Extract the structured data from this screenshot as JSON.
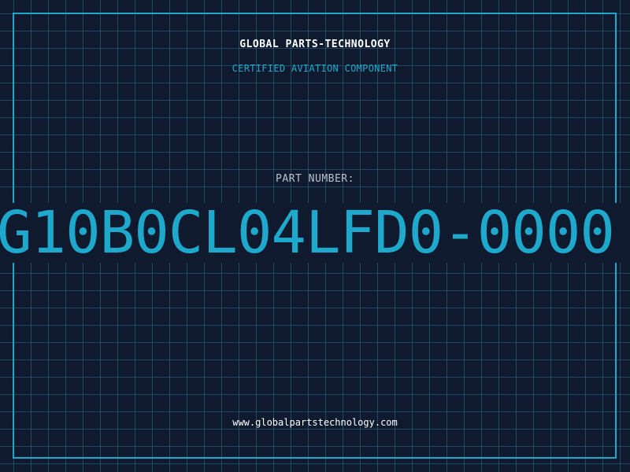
{
  "header": {
    "company": "GLOBAL PARTS-TECHNOLOGY",
    "subtitle": "CERTIFIED AVIATION COMPONENT"
  },
  "part": {
    "label": "PART NUMBER:",
    "number": "G10B0CL04LFD0-0000"
  },
  "footer": {
    "website": "www.globalpartstechnology.com"
  },
  "colors": {
    "background": "#101a2e",
    "accent": "#1ea9cc",
    "grid": "#286e8c",
    "label": "#b9c1cc",
    "text": "#ffffff"
  }
}
